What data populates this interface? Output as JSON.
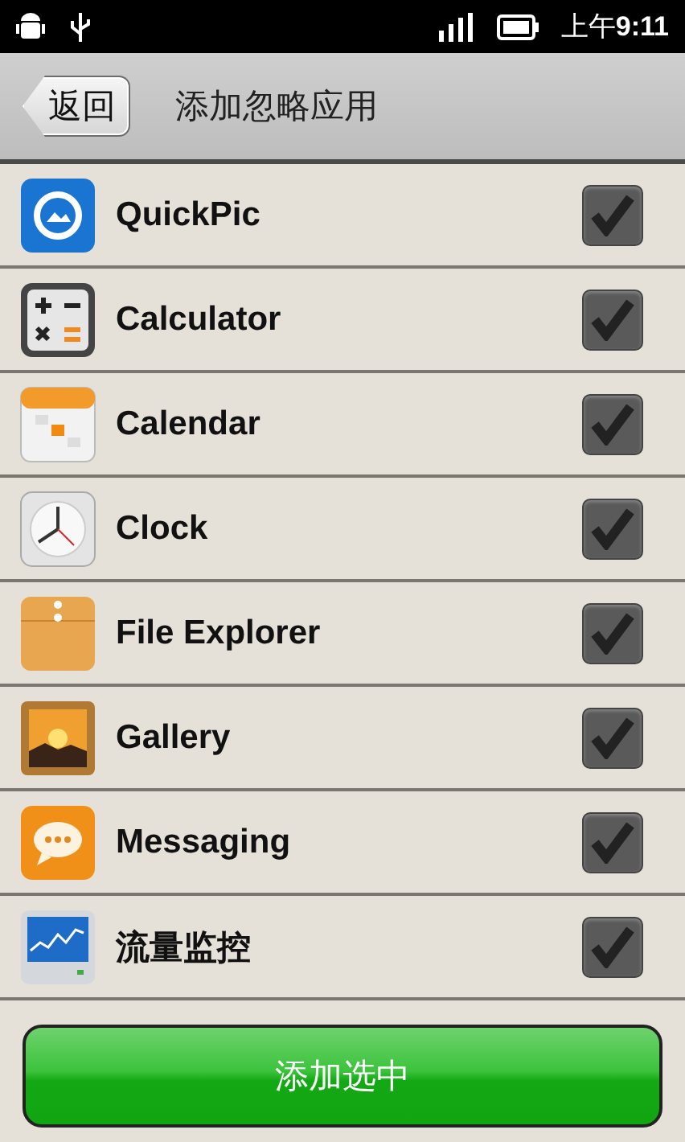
{
  "status_bar": {
    "time": "上午**9:11**"
  },
  "header": {
    "back_button": "返回",
    "title": "添加忽略应用"
  },
  "apps": [
    {
      "name": "QuickPic",
      "checked": true
    },
    {
      "name": "Calculator",
      "checked": true
    },
    {
      "name": "Calendar",
      "checked": true
    },
    {
      "name": "Clock",
      "checked": true
    },
    {
      "name": "File Explorer",
      "checked": true
    },
    {
      "name": "Gallery",
      "checked": true
    },
    {
      "name": "Messaging",
      "checked": true
    },
    {
      "name": "流量监控",
      "checked": true
    }
  ],
  "add_button": "添加选中"
}
